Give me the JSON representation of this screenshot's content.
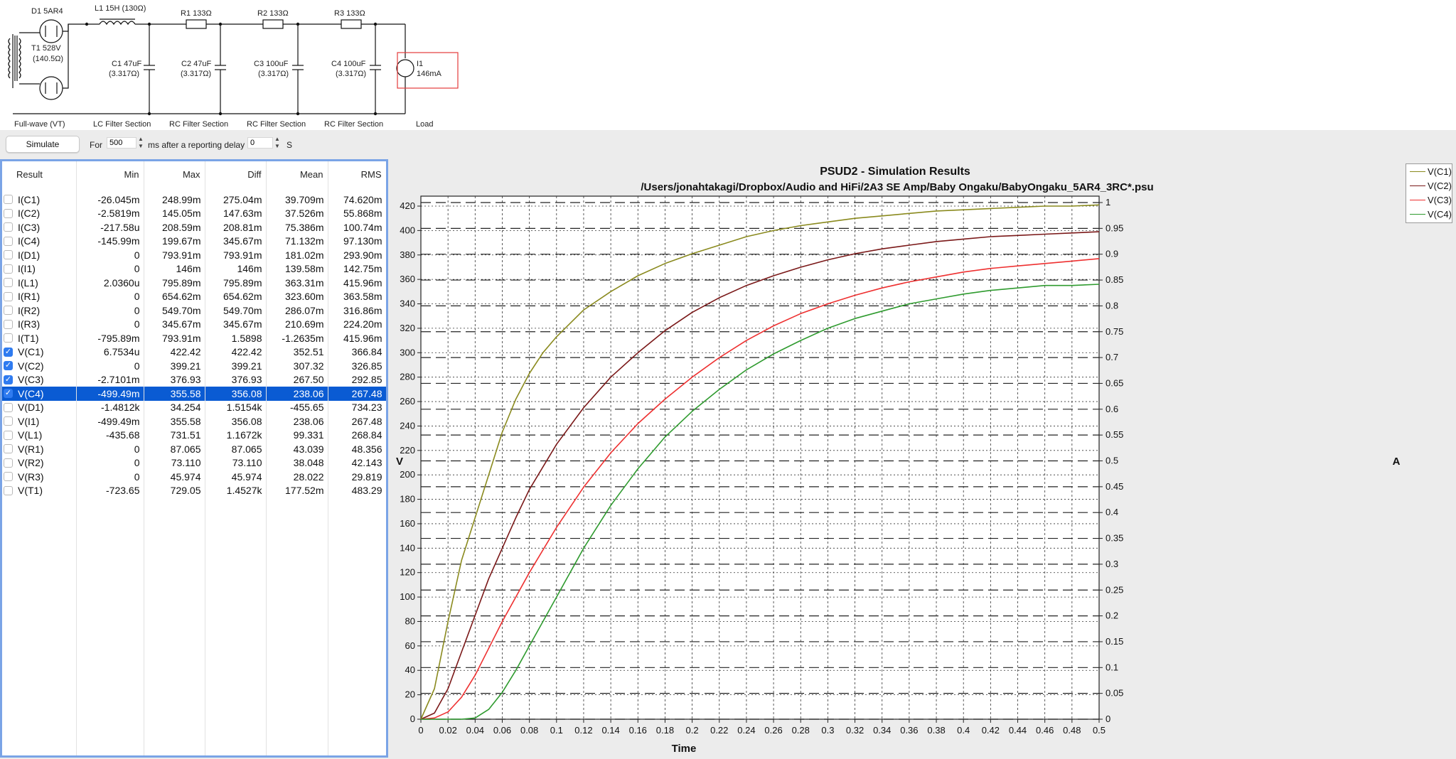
{
  "schematic": {
    "components": {
      "d1": "D1 5AR4",
      "t1": "T1 528V",
      "t1_r": "(140.5Ω)",
      "l1": "L1 15H (130Ω)",
      "r1": "R1 133Ω",
      "r2": "R2 133Ω",
      "r3": "R3 133Ω",
      "c1": "C1 47uF",
      "c1_r": "(3.317Ω)",
      "c2": "C2 47uF",
      "c2_r": "(3.317Ω)",
      "c3": "C3 100uF",
      "c3_r": "(3.317Ω)",
      "c4": "C4 100uF",
      "c4_r": "(3.317Ω)",
      "i1": "I1",
      "i1_val": "146mA"
    },
    "sections": [
      "Full-wave (VT)",
      "LC Filter Section",
      "RC Filter Section",
      "RC Filter Section",
      "RC Filter Section",
      "Load"
    ]
  },
  "controls": {
    "simulate_label": "Simulate",
    "for_label": "For",
    "duration_value": "500",
    "after_label": "ms after a reporting delay",
    "delay_value": "0",
    "delay_unit": "S"
  },
  "results": {
    "headers": [
      "Result",
      "Min",
      "Max",
      "Diff",
      "Mean",
      "RMS"
    ],
    "rows": [
      {
        "name": "I(C1)",
        "min": "-26.045m",
        "max": "248.99m",
        "diff": "275.04m",
        "mean": "39.709m",
        "rms": "74.620m",
        "checked": false,
        "selected": false
      },
      {
        "name": "I(C2)",
        "min": "-2.5819m",
        "max": "145.05m",
        "diff": "147.63m",
        "mean": "37.526m",
        "rms": "55.868m",
        "checked": false,
        "selected": false
      },
      {
        "name": "I(C3)",
        "min": "-217.58u",
        "max": "208.59m",
        "diff": "208.81m",
        "mean": "75.386m",
        "rms": "100.74m",
        "checked": false,
        "selected": false
      },
      {
        "name": "I(C4)",
        "min": "-145.99m",
        "max": "199.67m",
        "diff": "345.67m",
        "mean": "71.132m",
        "rms": "97.130m",
        "checked": false,
        "selected": false
      },
      {
        "name": "I(D1)",
        "min": "0",
        "max": "793.91m",
        "diff": "793.91m",
        "mean": "181.02m",
        "rms": "293.90m",
        "checked": false,
        "selected": false
      },
      {
        "name": "I(I1)",
        "min": "0",
        "max": "146m",
        "diff": "146m",
        "mean": "139.58m",
        "rms": "142.75m",
        "checked": false,
        "selected": false
      },
      {
        "name": "I(L1)",
        "min": "2.0360u",
        "max": "795.89m",
        "diff": "795.89m",
        "mean": "363.31m",
        "rms": "415.96m",
        "checked": false,
        "selected": false
      },
      {
        "name": "I(R1)",
        "min": "0",
        "max": "654.62m",
        "diff": "654.62m",
        "mean": "323.60m",
        "rms": "363.58m",
        "checked": false,
        "selected": false
      },
      {
        "name": "I(R2)",
        "min": "0",
        "max": "549.70m",
        "diff": "549.70m",
        "mean": "286.07m",
        "rms": "316.86m",
        "checked": false,
        "selected": false
      },
      {
        "name": "I(R3)",
        "min": "0",
        "max": "345.67m",
        "diff": "345.67m",
        "mean": "210.69m",
        "rms": "224.20m",
        "checked": false,
        "selected": false
      },
      {
        "name": "I(T1)",
        "min": "-795.89m",
        "max": "793.91m",
        "diff": "1.5898",
        "mean": "-1.2635m",
        "rms": "415.96m",
        "checked": false,
        "selected": false
      },
      {
        "name": "V(C1)",
        "min": "6.7534u",
        "max": "422.42",
        "diff": "422.42",
        "mean": "352.51",
        "rms": "366.84",
        "checked": true,
        "selected": false
      },
      {
        "name": "V(C2)",
        "min": "0",
        "max": "399.21",
        "diff": "399.21",
        "mean": "307.32",
        "rms": "326.85",
        "checked": true,
        "selected": false
      },
      {
        "name": "V(C3)",
        "min": "-2.7101m",
        "max": "376.93",
        "diff": "376.93",
        "mean": "267.50",
        "rms": "292.85",
        "checked": true,
        "selected": false
      },
      {
        "name": "V(C4)",
        "min": "-499.49m",
        "max": "355.58",
        "diff": "356.08",
        "mean": "238.06",
        "rms": "267.48",
        "checked": true,
        "selected": true
      },
      {
        "name": "V(D1)",
        "min": "-1.4812k",
        "max": "34.254",
        "diff": "1.5154k",
        "mean": "-455.65",
        "rms": "734.23",
        "checked": false,
        "selected": false
      },
      {
        "name": "V(I1)",
        "min": "-499.49m",
        "max": "355.58",
        "diff": "356.08",
        "mean": "238.06",
        "rms": "267.48",
        "checked": false,
        "selected": false
      },
      {
        "name": "V(L1)",
        "min": "-435.68",
        "max": "731.51",
        "diff": "1.1672k",
        "mean": "99.331",
        "rms": "268.84",
        "checked": false,
        "selected": false
      },
      {
        "name": "V(R1)",
        "min": "0",
        "max": "87.065",
        "diff": "87.065",
        "mean": "43.039",
        "rms": "48.356",
        "checked": false,
        "selected": false
      },
      {
        "name": "V(R2)",
        "min": "0",
        "max": "73.110",
        "diff": "73.110",
        "mean": "38.048",
        "rms": "42.143",
        "checked": false,
        "selected": false
      },
      {
        "name": "V(R3)",
        "min": "0",
        "max": "45.974",
        "diff": "45.974",
        "mean": "28.022",
        "rms": "29.819",
        "checked": false,
        "selected": false
      },
      {
        "name": "V(T1)",
        "min": "-723.65",
        "max": "729.05",
        "diff": "1.4527k",
        "mean": "177.52m",
        "rms": "483.29",
        "checked": false,
        "selected": false
      }
    ]
  },
  "chart_data": {
    "type": "line",
    "title": "PSUD2 - Simulation Results",
    "subtitle": "/Users/jonahtakagi/Dropbox/Audio and HiFi/2A3 SE Amp/Baby Ongaku/BabyOngaku_5AR4_3RC*.psu",
    "xlabel": "Time",
    "ylabel": "V",
    "y2label": "A",
    "xlim": [
      0,
      0.5
    ],
    "ylim": [
      0,
      422
    ],
    "y2lim": [
      0,
      1
    ],
    "x_ticks": [
      "0",
      "0.02",
      "0.04",
      "0.06",
      "0.08",
      "0.1",
      "0.12",
      "0.14",
      "0.16",
      "0.18",
      "0.2",
      "0.22",
      "0.24",
      "0.26",
      "0.28",
      "0.3",
      "0.32",
      "0.34",
      "0.36",
      "0.38",
      "0.4",
      "0.42",
      "0.44",
      "0.46",
      "0.48",
      "0.5"
    ],
    "y_ticks": [
      "0",
      "20",
      "40",
      "60",
      "80",
      "100",
      "120",
      "140",
      "160",
      "180",
      "200",
      "220",
      "240",
      "260",
      "280",
      "300",
      "320",
      "340",
      "360",
      "380",
      "400",
      "420"
    ],
    "y2_ticks": [
      "0",
      "0.05",
      "0.1",
      "0.15",
      "0.2",
      "0.25",
      "0.3",
      "0.35",
      "0.4",
      "0.45",
      "0.5",
      "0.55",
      "0.6",
      "0.65",
      "0.7",
      "0.75",
      "0.8",
      "0.85",
      "0.9",
      "0.95",
      "1"
    ],
    "grid": true,
    "legend_position": "top-right",
    "series": [
      {
        "name": "V(C1)",
        "color": "#8a8a1e",
        "x": [
          0,
          0.01,
          0.02,
          0.03,
          0.04,
          0.05,
          0.06,
          0.07,
          0.08,
          0.09,
          0.1,
          0.12,
          0.14,
          0.16,
          0.18,
          0.2,
          0.22,
          0.24,
          0.26,
          0.28,
          0.3,
          0.32,
          0.34,
          0.36,
          0.38,
          0.4,
          0.42,
          0.44,
          0.46,
          0.48,
          0.5
        ],
        "y": [
          0,
          25,
          80,
          130,
          165,
          200,
          235,
          262,
          283,
          300,
          313,
          335,
          350,
          363,
          373,
          381,
          388,
          395,
          400,
          404,
          407,
          410,
          412,
          414,
          416,
          417,
          418,
          419,
          420,
          420,
          421
        ]
      },
      {
        "name": "V(C2)",
        "color": "#7a1818",
        "x": [
          0,
          0.01,
          0.02,
          0.03,
          0.04,
          0.05,
          0.06,
          0.07,
          0.08,
          0.1,
          0.12,
          0.14,
          0.16,
          0.18,
          0.2,
          0.22,
          0.24,
          0.26,
          0.28,
          0.3,
          0.32,
          0.34,
          0.36,
          0.38,
          0.4,
          0.42,
          0.44,
          0.46,
          0.48,
          0.5
        ],
        "y": [
          0,
          5,
          25,
          55,
          85,
          115,
          140,
          165,
          188,
          225,
          255,
          280,
          300,
          318,
          333,
          345,
          355,
          363,
          370,
          376,
          381,
          385,
          388,
          391,
          393,
          395,
          396,
          397,
          398,
          399
        ]
      },
      {
        "name": "V(C3)",
        "color": "#ee3030",
        "x": [
          0,
          0.01,
          0.02,
          0.03,
          0.04,
          0.05,
          0.06,
          0.08,
          0.1,
          0.12,
          0.14,
          0.16,
          0.18,
          0.2,
          0.22,
          0.24,
          0.26,
          0.28,
          0.3,
          0.32,
          0.34,
          0.36,
          0.38,
          0.4,
          0.42,
          0.44,
          0.46,
          0.48,
          0.5
        ],
        "y": [
          0,
          1,
          6,
          18,
          36,
          58,
          80,
          120,
          157,
          190,
          218,
          242,
          262,
          280,
          296,
          310,
          322,
          332,
          340,
          347,
          353,
          358,
          362,
          366,
          369,
          371,
          373,
          375,
          377
        ]
      },
      {
        "name": "V(C4)",
        "color": "#2f9b2f",
        "x": [
          0,
          0.02,
          0.03,
          0.04,
          0.05,
          0.06,
          0.07,
          0.08,
          0.1,
          0.12,
          0.14,
          0.16,
          0.18,
          0.2,
          0.22,
          0.24,
          0.26,
          0.28,
          0.3,
          0.32,
          0.34,
          0.36,
          0.38,
          0.4,
          0.42,
          0.44,
          0.46,
          0.48,
          0.5
        ],
        "y": [
          0,
          0,
          0,
          1,
          8,
          22,
          40,
          60,
          100,
          140,
          175,
          205,
          231,
          252,
          270,
          286,
          299,
          310,
          320,
          328,
          334,
          340,
          344,
          348,
          351,
          353,
          355,
          355,
          356
        ]
      }
    ]
  }
}
